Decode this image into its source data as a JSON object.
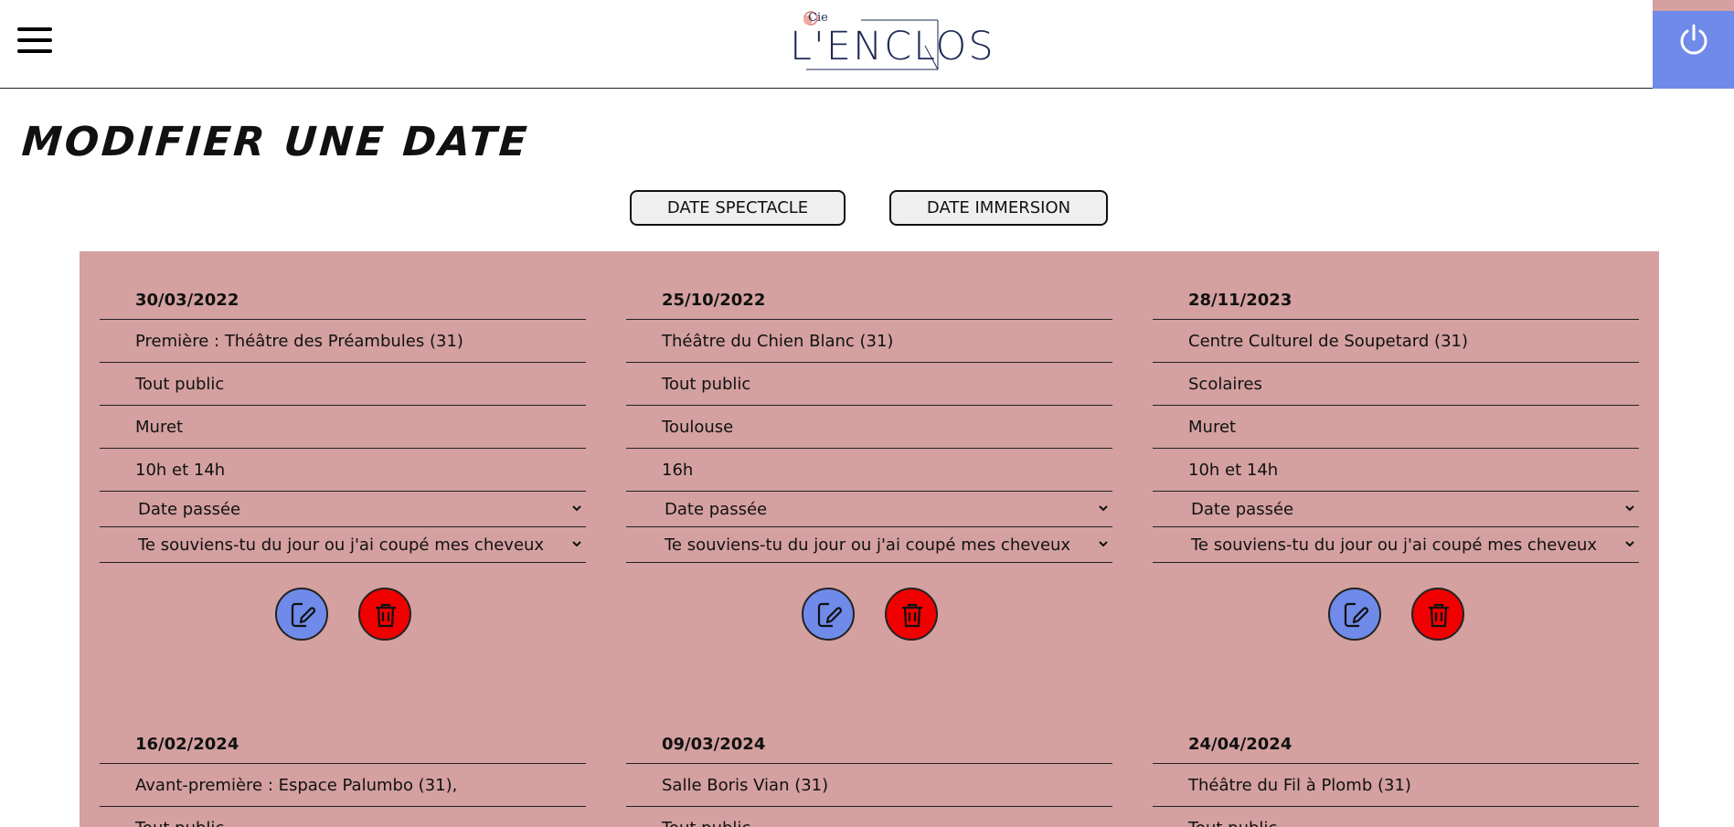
{
  "header": {
    "logo_small": "Cie",
    "logo_name": "L'ENCLOS",
    "menu_icon": "hamburger-icon",
    "power_icon": "power-icon",
    "colors": {
      "power_bg": "#6f8ae8",
      "power_strip": "#d4a0a0"
    }
  },
  "page": {
    "title": "MODIFIER UNE DATE"
  },
  "tabs": {
    "spectacle": "DATE SPECTACLE",
    "immersion": "DATE IMMERSION"
  },
  "colors": {
    "panel_bg": "#d4a0a0",
    "edit_button": "#6f8ae8",
    "delete_button": "#f00000"
  },
  "cards": [
    {
      "date": "30/03/2022",
      "venue": "Première : Théâtre des Préambules (31)",
      "audience": "Tout public",
      "city": "Muret",
      "time": "10h et 14h",
      "status": "Date passée",
      "show": "Te souviens-tu du jour ou j'ai coupé mes cheveux"
    },
    {
      "date": "25/10/2022",
      "venue": "Théâtre du Chien Blanc (31)",
      "audience": "Tout public",
      "city": "Toulouse",
      "time": "16h",
      "status": "Date passée",
      "show": "Te souviens-tu du jour ou j'ai coupé mes cheveux"
    },
    {
      "date": "28/11/2023",
      "venue": "Centre Culturel de Soupetard (31)",
      "audience": "Scolaires",
      "city": "Muret",
      "time": "10h et 14h",
      "status": "Date passée",
      "show": "Te souviens-tu du jour ou j'ai coupé mes cheveux"
    },
    {
      "date": "16/02/2024",
      "venue": "Avant-première : Espace Palumbo (31),",
      "audience": "Tout public"
    },
    {
      "date": "09/03/2024",
      "venue": "Salle Boris Vian (31)",
      "audience": "Tout public"
    },
    {
      "date": "24/04/2024",
      "venue": "Théâtre du Fil à Plomb (31)",
      "audience": "Tout public"
    }
  ]
}
